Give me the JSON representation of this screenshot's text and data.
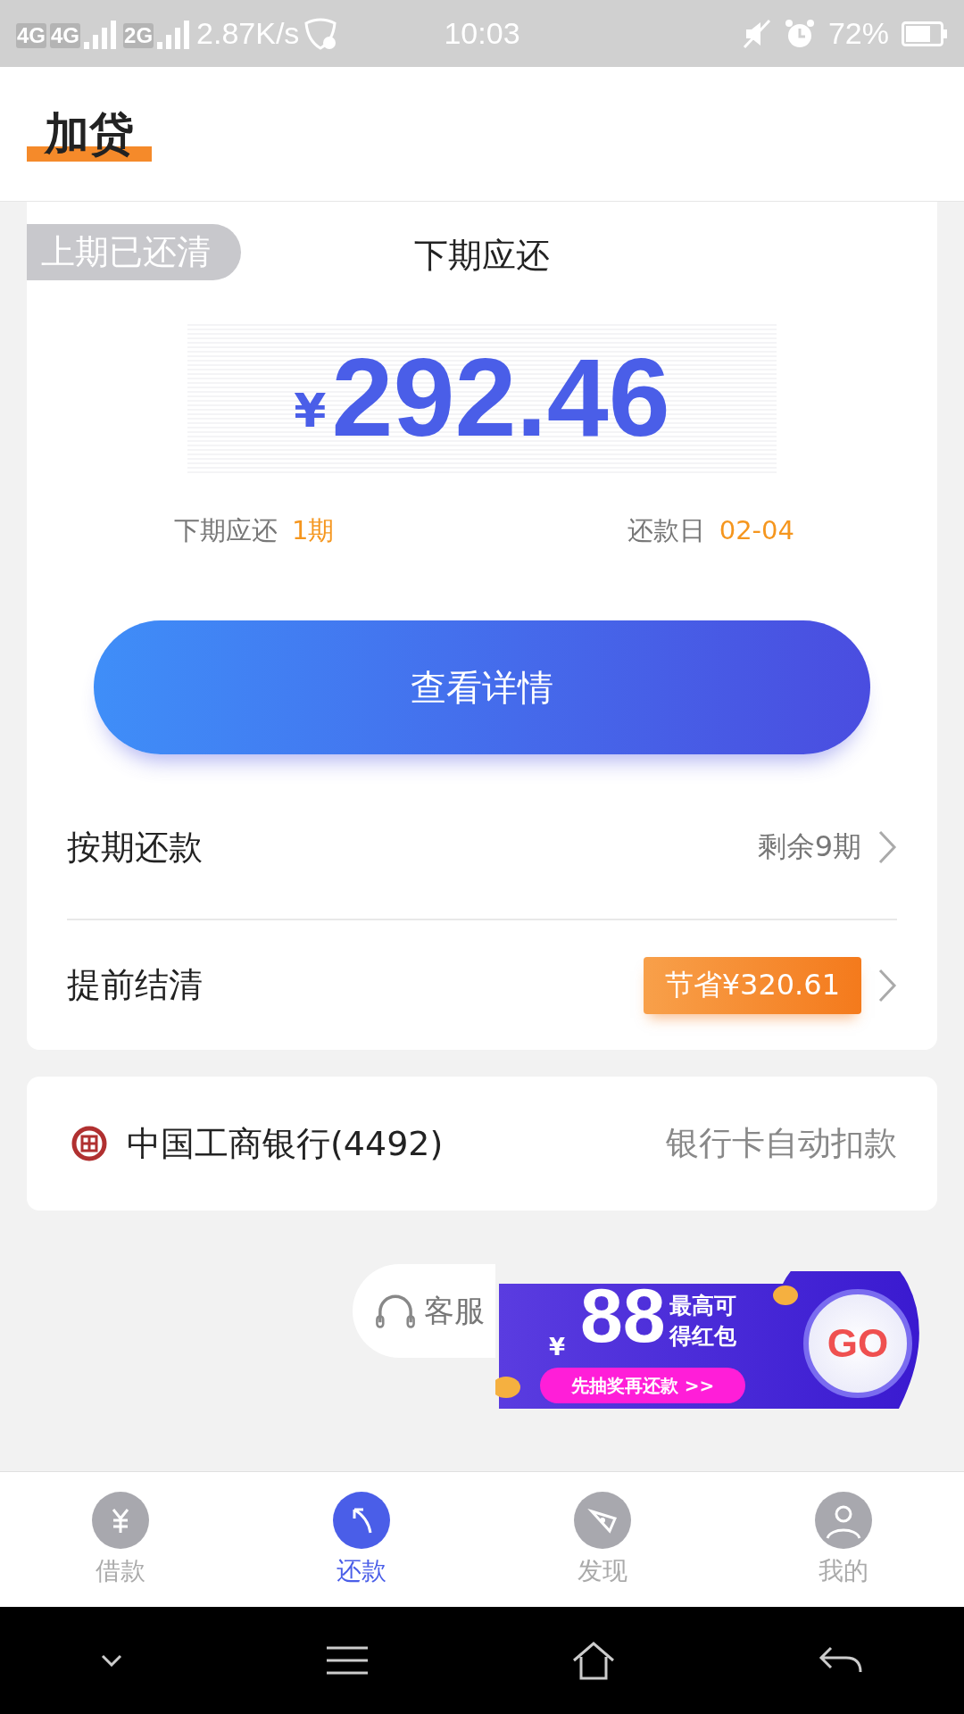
{
  "status_bar": {
    "network_1": "4G",
    "network_2": "4G",
    "network_3": "2G",
    "speed": "2.87K/s",
    "time": "10:03",
    "battery": "72%"
  },
  "header": {
    "title": "加贷"
  },
  "repayment_card": {
    "badge": "上期已还清",
    "title": "下期应还",
    "currency": "¥",
    "amount": "292.46",
    "period_label": "下期应还",
    "period_value": "1期",
    "due_label": "还款日",
    "due_value": "02-04",
    "button": "查看详情",
    "rows": [
      {
        "kind": "plain",
        "label": "按期还款",
        "value": "剩余9期"
      },
      {
        "kind": "highlight",
        "label": "提前结清",
        "value": "节省¥320.61"
      }
    ]
  },
  "bank_card": {
    "name": "中国工商银行(4492)",
    "note": "银行卡自动扣款"
  },
  "service": {
    "label": "客服"
  },
  "promo": {
    "currency": "¥",
    "amount": "88",
    "line_1": "最高可",
    "line_2": "得红包",
    "action": "先抽奖再还款 >>",
    "go": "GO"
  },
  "tabs": [
    {
      "label": "借款",
      "selected": false
    },
    {
      "label": "还款",
      "selected": true
    },
    {
      "label": "发现",
      "selected": false
    },
    {
      "label": "我的",
      "selected": false
    }
  ]
}
